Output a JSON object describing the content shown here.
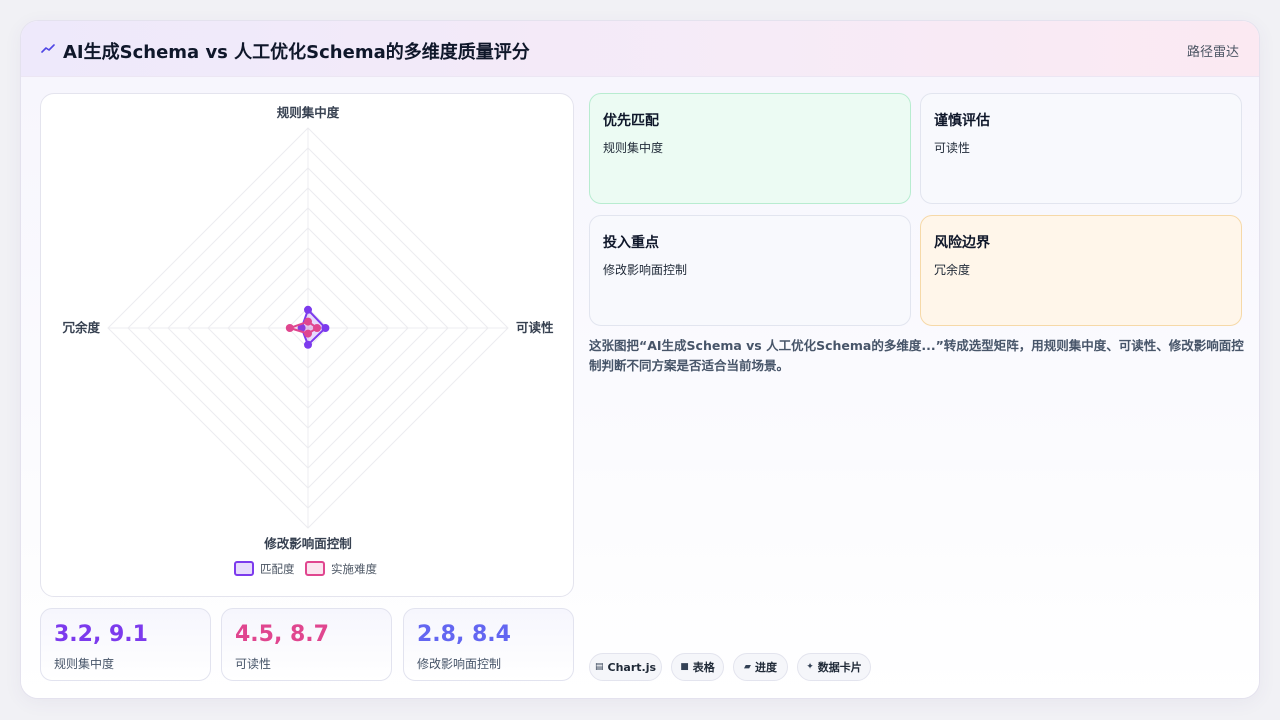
{
  "header": {
    "title": "AI生成Schema vs 人工优化Schema的多维度质量评分",
    "kind": "路径雷达",
    "icon": "line-chart-icon"
  },
  "chart_data": {
    "type": "radar",
    "axes": [
      "规则集中度",
      "可读性",
      "修改影响面控制",
      "冗余度"
    ],
    "rmax": 100,
    "series": [
      {
        "name": "匹配度",
        "values": [
          9.1,
          8.7,
          8.4,
          3.2
        ],
        "color": "#7c3aed"
      },
      {
        "name": "实施难度",
        "values": [
          3.2,
          4.5,
          2.8,
          9.1
        ],
        "color": "#e0468f"
      }
    ],
    "legend_position": "bottom"
  },
  "stats": [
    {
      "value": "3.2, 9.1",
      "label": "规则集中度",
      "color": "#7c3aed"
    },
    {
      "value": "4.5, 8.7",
      "label": "可读性",
      "color": "#e0468f"
    },
    {
      "value": "2.8, 8.4",
      "label": "修改影响面控制",
      "color": "#6366f1"
    }
  ],
  "tiles": [
    {
      "title": "优先匹配",
      "value": "规则集中度",
      "bg": "#ecfbf3",
      "border": "#b8ecd0"
    },
    {
      "title": "谨慎评估",
      "value": "可读性",
      "bg": "#f8f9fd",
      "border": "#e2e5ef"
    },
    {
      "title": "投入重点",
      "value": "修改影响面控制",
      "bg": "#f8f9fd",
      "border": "#e2e5ef"
    },
    {
      "title": "风险边界",
      "value": "冗余度",
      "bg": "#fff6ea",
      "border": "#f6d9a8"
    }
  ],
  "description": "这张图把“AI生成Schema vs 人工优化Schema的多维度...”转成选型矩阵，用规则集中度、可读性、修改影响面控制判断不同方案是否适合当前场景。",
  "chips": [
    {
      "icon": "chart-icon",
      "glyph": "▤",
      "label": "Chart.js"
    },
    {
      "icon": "table-icon",
      "glyph": "■",
      "label": "表格"
    },
    {
      "icon": "progress-icon",
      "glyph": "▰",
      "label": "进度"
    },
    {
      "icon": "data-card-icon",
      "glyph": "✦",
      "label": "数据卡片"
    }
  ]
}
